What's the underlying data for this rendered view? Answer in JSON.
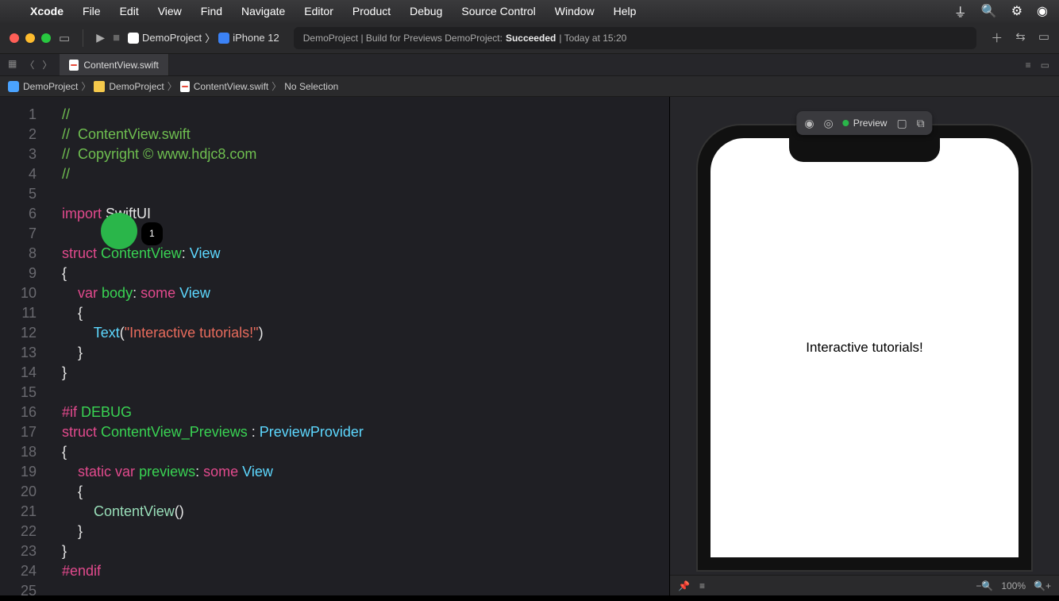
{
  "menubar": {
    "app": "Xcode",
    "items": [
      "File",
      "Edit",
      "View",
      "Find",
      "Navigate",
      "Editor",
      "Product",
      "Debug",
      "Source Control",
      "Window",
      "Help"
    ]
  },
  "toolbar": {
    "scheme_project": "DemoProject",
    "scheme_device": "iPhone 12",
    "status_prefix": "DemoProject | Build for Previews DemoProject: ",
    "status_result": "Succeeded",
    "status_time": " | Today at 15:20"
  },
  "tabbar": {
    "active_tab": "ContentView.swift"
  },
  "jumpbar": {
    "c1": "DemoProject",
    "c2": "DemoProject",
    "c3": "ContentView.swift",
    "c4": "No Selection"
  },
  "editor": {
    "lines": [
      "1",
      "2",
      "3",
      "4",
      "5",
      "6",
      "7",
      "8",
      "9",
      "10",
      "11",
      "12",
      "13",
      "14",
      "15",
      "16",
      "17",
      "18",
      "19",
      "20",
      "21",
      "22",
      "23",
      "24",
      "25"
    ],
    "comment1": "//",
    "comment2": "//  ContentView.swift",
    "comment3": "//  Copyright © www.hdjc8.com",
    "comment4": "//",
    "import_kw": "import",
    "import_mod": " SwiftUI",
    "struct_kw": "struct",
    "struct_name": " ContentView",
    "colon_view": ": ",
    "view_type": "View",
    "brace_o": "{",
    "var_kw": "var",
    "body_id": " body",
    "colon": ": ",
    "some_kw": "some",
    "space": " ",
    "text_fn": "Text",
    "paren_o": "(",
    "string": "\"Interactive tutorials!\"",
    "paren_c": ")",
    "brace_c": "}",
    "ifdebug": "#if",
    "debug_id": " DEBUG",
    "previews_name": " ContentView_Previews ",
    "previews_colon": ": ",
    "provider_type": "PreviewProvider",
    "static_kw": "static",
    "previews_id": " previews",
    "cv_call": "ContentView",
    "parens": "()",
    "endif": "#endif",
    "cursor_badge": "1"
  },
  "preview": {
    "label": "Preview",
    "phone_text": "Interactive tutorials!",
    "zoom": "100%"
  }
}
